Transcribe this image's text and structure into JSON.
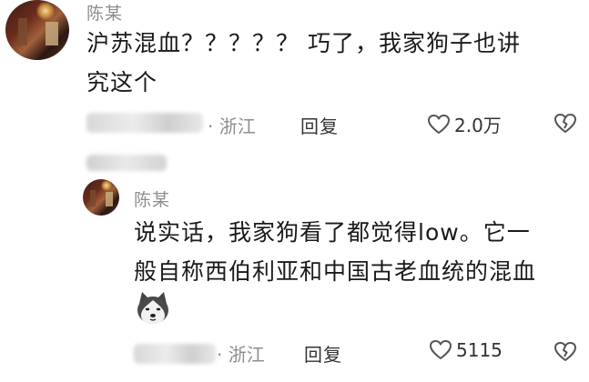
{
  "comments": [
    {
      "name": "陈某",
      "text_line1": "沪苏混血？？？？？ 巧了，我家狗子也讲",
      "text_line2": "究这个",
      "location": "· 浙江",
      "reply_label": "回复",
      "likes": "2.0万",
      "avatar_icon": "avatar-photo"
    },
    {
      "name": "陈某",
      "text_line1": "说实话，我家狗看了都觉得low。它一",
      "text_line2": "般自称西伯利亚和中国古老血统的混血",
      "sticker_icon": "husky-dog-emoji",
      "location": "· 浙江",
      "reply_label": "回复",
      "likes": "5115",
      "avatar_icon": "avatar-photo"
    }
  ],
  "icons": {
    "like": "heart-outline-icon",
    "dislike": "broken-heart-icon"
  }
}
